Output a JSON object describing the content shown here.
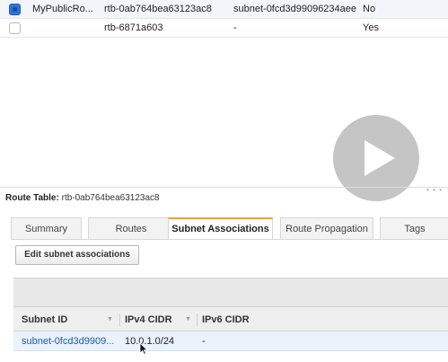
{
  "route_tables": [
    {
      "selected": true,
      "name": "MyPublicRo...",
      "route_table_id": "rtb-0ab764bea63123ac8",
      "explicit_association": "subnet-0fcd3d99096234aee",
      "main": "No"
    },
    {
      "selected": false,
      "name": "",
      "route_table_id": "rtb-6871a603",
      "explicit_association": "-",
      "main": "Yes"
    }
  ],
  "detail": {
    "label": "Route Table:",
    "value": "rtb-0ab764bea63123ac8"
  },
  "tabs": [
    {
      "label": "Summary",
      "active": false
    },
    {
      "label": "Routes",
      "active": false
    },
    {
      "label": "Subnet Associations",
      "active": true
    },
    {
      "label": "Route Propagation",
      "active": false
    },
    {
      "label": "Tags",
      "active": false
    }
  ],
  "edit_button_label": "Edit subnet associations",
  "associations": {
    "columns": [
      "Subnet ID",
      "IPv4 CIDR",
      "IPv6 CIDR"
    ],
    "rows": [
      {
        "subnet_id": "subnet-0fcd3d9909...",
        "ipv4_cidr": "10.0.1.0/24",
        "ipv6_cidr": "-"
      }
    ]
  },
  "colors": {
    "active_tab_accent": "#e8a33d",
    "link": "#1a5fa8",
    "checkbox_selected": "#2e73d8"
  }
}
